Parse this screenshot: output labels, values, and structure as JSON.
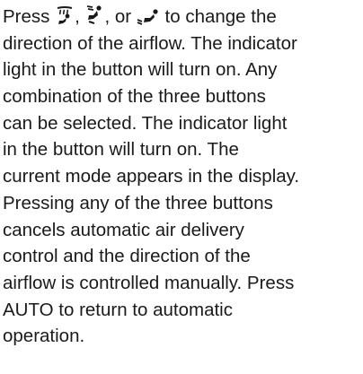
{
  "paragraph": {
    "line1": {
      "prefix": "Press ",
      "sep1": ", ",
      "sep2": ", or ",
      "suffix": " to change the",
      "icons": [
        "airflow-windshield-icon",
        "airflow-upper-body-icon",
        "airflow-feet-icon"
      ]
    },
    "lines": [
      "direction of the airflow. The indicator",
      "light in the button will turn on. Any",
      "combination of the three buttons",
      "can be selected. The indicator light",
      "in the button will turn on. The",
      "current mode appears in the display.",
      "Pressing any of the three buttons",
      "cancels automatic air delivery",
      "control and the direction of the",
      "airflow is controlled manually. Press",
      "AUTO to return to automatic",
      "operation."
    ]
  }
}
